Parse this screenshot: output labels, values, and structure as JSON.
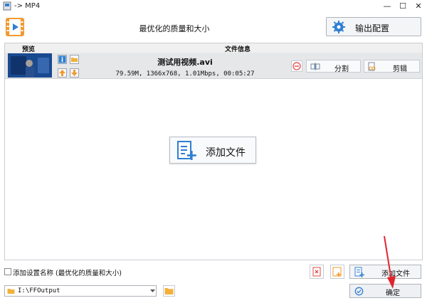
{
  "window": {
    "title": "-> MP4",
    "min": "—",
    "max": "☐",
    "close": "✕"
  },
  "toolbar": {
    "profile_title": "最优化的质量和大小",
    "output_config_label": "输出配置"
  },
  "list": {
    "header_preview": "预览",
    "header_fileinfo": "文件信息",
    "file": {
      "name": "测试用视频.avi",
      "meta": "79.59M, 1366x768, 1.01Mbps, 00:05:27"
    },
    "split_label": "分割",
    "trim_label": "剪辑",
    "add_file_big_label": "添加文件"
  },
  "bottom": {
    "checkbox_label": "添加设置名称 (最优化的质量和大小)",
    "add_file_label": "添加文件",
    "output_path": "I:\\FFOutput",
    "confirm_label": "确定"
  },
  "colors": {
    "accent_blue": "#2f7fd1",
    "orange": "#f29a2e",
    "red": "#e24a4a",
    "arrow_red": "#e0242d"
  }
}
